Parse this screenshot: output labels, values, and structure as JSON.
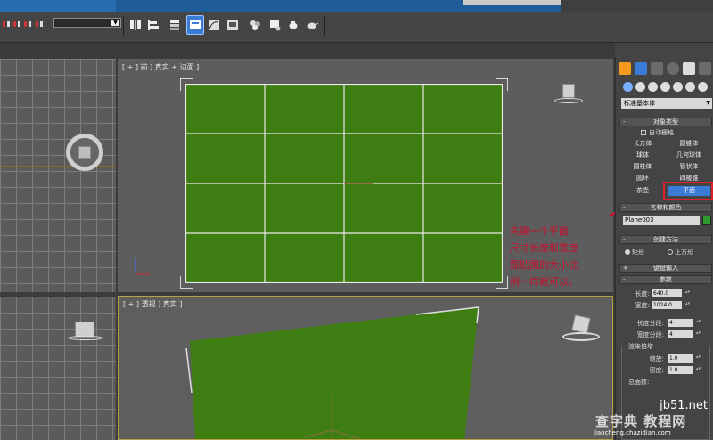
{
  "viewports": {
    "top_left": {
      "label": ""
    },
    "front": {
      "label": "[ + ] 前 ] 真实 + 边面 ]"
    },
    "bottom_left": {
      "label": ""
    },
    "perspective": {
      "label": "[ + ] 透视 ] 真实 ]"
    }
  },
  "annotation": {
    "line1": "先建一个平面,",
    "line2": "尺寸长度和宽度",
    "line3": "跟贴图的大小比",
    "line4": "例一样就可以。"
  },
  "command_panel": {
    "category_select": "标准基本体",
    "object_type": {
      "title": "对象类型",
      "autogrid_label": "自动栅格",
      "buttons": [
        "长方体",
        "圆锥体",
        "球体",
        "几何球体",
        "圆柱体",
        "管状体",
        "圆环",
        "四棱锥",
        "茶壶",
        "平面"
      ],
      "active_index": 9
    },
    "name_color": {
      "title": "名称和颜色",
      "name_value": "Plane003",
      "swatch_color": "#2f9a2f"
    },
    "creation_method": {
      "title": "创建方法",
      "options": [
        "矩形",
        "正方形"
      ]
    },
    "keyboard_entry": {
      "title": "键盘输入"
    },
    "parameters": {
      "title": "参数",
      "length_label": "长度:",
      "length_value": "640.0",
      "width_label": "宽度:",
      "width_value": "1024.0",
      "length_segs_label": "长度分段:",
      "length_segs_value": "4",
      "width_segs_label": "宽度分段:",
      "width_segs_value": "4",
      "render_mult_title": "渲染倍增",
      "scale_label": "缩放:",
      "scale_value": "1.0",
      "density_label": "密度:",
      "density_value": "1.0",
      "total_faces_label": "总面数:"
    }
  },
  "watermark": {
    "site": "jb51.net",
    "cn": "查字典 教程网",
    "url": "jiaocheng.chazidian.com"
  },
  "colors": {
    "plane_green": "#3e7d12",
    "highlight_red": "#e0202a",
    "annotation_red": "#c8102e",
    "accent_blue": "#3a7bd5"
  }
}
